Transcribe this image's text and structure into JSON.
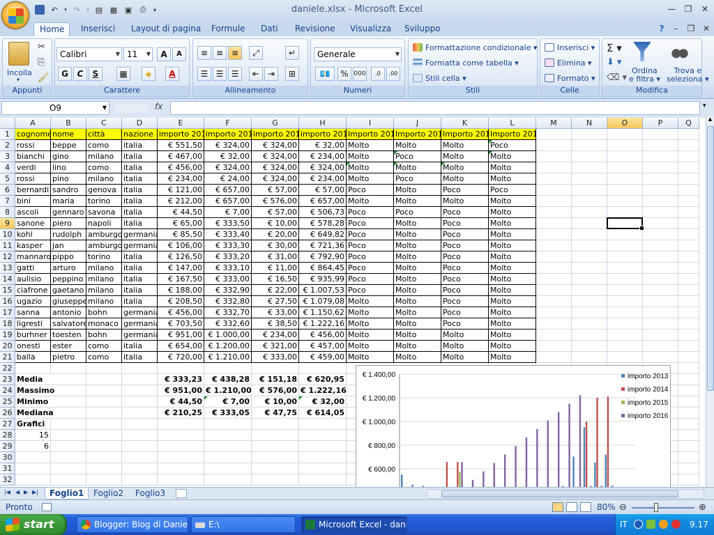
{
  "window": {
    "title": "daniele.xlsx - Microsoft Excel"
  },
  "ribbon_tabs": [
    "Home",
    "Inserisci",
    "Layout di pagina",
    "Formule",
    "Dati",
    "Revisione",
    "Visualizza",
    "Sviluppo"
  ],
  "ribbon": {
    "groups": {
      "appunti": "Appunti",
      "carattere": "Carattere",
      "allineamento": "Allineamento",
      "numeri": "Numeri",
      "stili": "Stili",
      "celle": "Celle",
      "modifica": "Modifica"
    },
    "incolla": "Incolla",
    "font_name": "Calibri",
    "font_size": "11",
    "number_format": "Generale",
    "formattazione": "Formattazione condizionale",
    "formatta_tabella": "Formatta come tabella",
    "stili_cella": "Stili cella",
    "inserisci": "Inserisci",
    "elimina": "Elimina",
    "formato": "Formato",
    "ordina": "Ordina",
    "ordina2": "e filtra",
    "trova": "Trova e",
    "trova2": "seleziona",
    "bold": "G",
    "italic": "C",
    "underline": "S"
  },
  "formula_bar": {
    "name_box": "O9",
    "fx": "fx",
    "content": ""
  },
  "columns": [
    "A",
    "B",
    "C",
    "D",
    "E",
    "F",
    "G",
    "H",
    "I",
    "J",
    "K",
    "L",
    "M",
    "N",
    "O",
    "P",
    "Q"
  ],
  "rows": [
    "1",
    "2",
    "3",
    "4",
    "5",
    "6",
    "7",
    "8",
    "9",
    "10",
    "11",
    "12",
    "13",
    "14",
    "15",
    "16",
    "17",
    "18",
    "19",
    "20",
    "21",
    "22",
    "23",
    "24",
    "25",
    "26",
    "27",
    "28",
    "29",
    "30",
    "31",
    "32"
  ],
  "header_row": [
    "cognome",
    "nome",
    "città",
    "nazione",
    "importo 2013",
    "importo 2014",
    "importo 2013",
    "importo 2014",
    "Importo 2013",
    "Importo 2014",
    "Importo 2015",
    "Importo 2016"
  ],
  "data_rows": [
    [
      "rossi",
      "beppe",
      "como",
      "italia",
      "€ 551,50",
      "€ 324,00",
      "€ 324,00",
      "€ 32,00",
      "Molto",
      "Molto",
      "Molto",
      "Poco"
    ],
    [
      "bianchi",
      "gino",
      "milano",
      "italia",
      "€ 467,00",
      "€ 32,00",
      "€ 324,00",
      "€ 234,00",
      "Molto",
      "Poco",
      "Molto",
      "Molto"
    ],
    [
      "verdi",
      "lino",
      "como",
      "italia",
      "€ 456,00",
      "€ 324,00",
      "€ 324,00",
      "€ 324,00",
      "Molto",
      "Molto",
      "Molto",
      "Molto"
    ],
    [
      "rossi",
      "pino",
      "milano",
      "italia",
      "€ 234,00",
      "€ 24,00",
      "€ 324,00",
      "€ 234,00",
      "Molto",
      "Poco",
      "Molto",
      "Molto"
    ],
    [
      "bernardi",
      "sandro",
      "genova",
      "italia",
      "€ 121,00",
      "€ 657,00",
      "€ 57,00",
      "€ 57,00",
      "Poco",
      "Molto",
      "Poco",
      "Poco"
    ],
    [
      "bini",
      "maria",
      "torino",
      "italia",
      "€ 212,00",
      "€ 657,00",
      "€ 576,00",
      "€ 657,00",
      "Molto",
      "Molto",
      "Molto",
      "Molto"
    ],
    [
      "ascoli",
      "gennaro",
      "savona",
      "italia",
      "€ 44,50",
      "€ 7,00",
      "€ 57,00",
      "€ 506,73",
      "Poco",
      "Poco",
      "Poco",
      "Molto"
    ],
    [
      "sanone",
      "piero",
      "napoli",
      "italia",
      "€ 65,00",
      "€ 333,50",
      "€ 10,00",
      "€ 578,28",
      "Poco",
      "Molto",
      "Poco",
      "Molto"
    ],
    [
      "kohl",
      "rudolph",
      "amburgo",
      "germania",
      "€ 85,50",
      "€ 333,40",
      "€ 20,00",
      "€ 649,82",
      "Poco",
      "Molto",
      "Poco",
      "Molto"
    ],
    [
      "kasper",
      "jan",
      "amburgo",
      "germania",
      "€ 106,00",
      "€ 333,30",
      "€ 30,00",
      "€ 721,36",
      "Poco",
      "Molto",
      "Poco",
      "Molto"
    ],
    [
      "mannaro",
      "pippo",
      "torino",
      "italia",
      "€ 126,50",
      "€ 333,20",
      "€ 31,00",
      "€ 792,90",
      "Poco",
      "Molto",
      "Poco",
      "Molto"
    ],
    [
      "gatti",
      "arturo",
      "milano",
      "italia",
      "€ 147,00",
      "€ 333,10",
      "€ 11,00",
      "€ 864,45",
      "Poco",
      "Molto",
      "Poco",
      "Molto"
    ],
    [
      "aulisio",
      "peppino",
      "milano",
      "italia",
      "€ 167,50",
      "€ 333,00",
      "€ 16,50",
      "€ 935,99",
      "Poco",
      "Molto",
      "Poco",
      "Molto"
    ],
    [
      "ciafrone",
      "gaetano",
      "milano",
      "italia",
      "€ 188,00",
      "€ 332,90",
      "€ 22,00",
      "€ 1.007,53",
      "Poco",
      "Molto",
      "Poco",
      "Molto"
    ],
    [
      "ugazio",
      "giuseppe",
      "milano",
      "italia",
      "€ 208,50",
      "€ 332,80",
      "€ 27,50",
      "€ 1.079,08",
      "Molto",
      "Molto",
      "Poco",
      "Molto"
    ],
    [
      "sanna",
      "antonio",
      "bohn",
      "germania",
      "€ 456,00",
      "€ 332,70",
      "€ 33,00",
      "€ 1.150,62",
      "Molto",
      "Molto",
      "Poco",
      "Molto"
    ],
    [
      "ligresti",
      "salvatore",
      "monaco",
      "germania",
      "€ 703,50",
      "€ 332,60",
      "€ 38,50",
      "€ 1.222,16",
      "Molto",
      "Molto",
      "Poco",
      "Molto"
    ],
    [
      "burhner",
      "toesten",
      "bohn",
      "germania",
      "€ 951,00",
      "€ 1.000,00",
      "€ 234,00",
      "€ 456,00",
      "Molto",
      "Molto",
      "Molto",
      "Molto"
    ],
    [
      "onesti",
      "ester",
      "como",
      "italia",
      "€ 654,00",
      "€ 1.200,00",
      "€ 321,00",
      "€ 457,00",
      "Molto",
      "Molto",
      "Molto",
      "Molto"
    ],
    [
      "balla",
      "pietro",
      "como",
      "italia",
      "€ 720,00",
      "€ 1.210,00",
      "€ 333,00",
      "€ 459,00",
      "Molto",
      "Molto",
      "Molto",
      "Molto"
    ]
  ],
  "stats": [
    {
      "label": "Media",
      "values": [
        "€ 333,23",
        "€ 438,28",
        "€ 151,18",
        "€ 620,95"
      ]
    },
    {
      "label": "Massimo",
      "values": [
        "€ 951,00",
        "€ 1.210,00",
        "€ 576,00",
        "€ 1.222,16"
      ]
    },
    {
      "label": "Minimo",
      "values": [
        "€ 44,50",
        "€ 7,00",
        "€ 10,00",
        "€ 32,00"
      ]
    },
    {
      "label": "Mediana",
      "values": [
        "€ 210,25",
        "€ 333,05",
        "€ 47,75",
        "€ 614,05"
      ]
    }
  ],
  "grafici": {
    "label": "Grafici",
    "v1": "15",
    "v2": "6"
  },
  "chart_data": {
    "type": "bar",
    "yticks": [
      "€ 1.400,00",
      "€ 1.200,00",
      "€ 1.000,00",
      "€ 800,00",
      "€ 600,00"
    ],
    "ylim": [
      500,
      1400
    ],
    "series": [
      {
        "name": "importo 2013",
        "color": "#4f81bd",
        "values": [
          551.5,
          467,
          456,
          234,
          121,
          212,
          44.5,
          65,
          85.5,
          106,
          126.5,
          147,
          167.5,
          188,
          208.5,
          456,
          703.5,
          951,
          654,
          720
        ]
      },
      {
        "name": "importo 2014",
        "color": "#c0504d",
        "values": [
          324,
          32,
          324,
          24,
          657,
          657,
          7,
          333.5,
          333.4,
          333.3,
          333.2,
          333.1,
          333,
          332.9,
          332.8,
          332.7,
          332.6,
          1000,
          1200,
          1210
        ]
      },
      {
        "name": "importo 2015",
        "color": "#9bbb59",
        "values": [
          324,
          324,
          324,
          324,
          57,
          576,
          57,
          10,
          20,
          30,
          31,
          11,
          16.5,
          22,
          27.5,
          33,
          38.5,
          234,
          321,
          333
        ]
      },
      {
        "name": "importo 2016",
        "color": "#8064a2",
        "values": [
          32,
          234,
          324,
          234,
          57,
          657,
          506.73,
          578.28,
          649.82,
          721.36,
          792.9,
          864.45,
          935.99,
          1007.53,
          1079.08,
          1150.62,
          1222.16,
          456,
          457,
          459
        ]
      }
    ]
  },
  "sheets": [
    "Foglio1",
    "Foglio2",
    "Foglio3"
  ],
  "status": {
    "ready": "Pronto",
    "zoom": "80%"
  },
  "taskbar": {
    "start": "start",
    "tasks": [
      "Blogger: Blog di Danie...",
      "E:\\",
      "Microsoft Excel - dani..."
    ],
    "lang": "IT",
    "clock": "9.17"
  }
}
